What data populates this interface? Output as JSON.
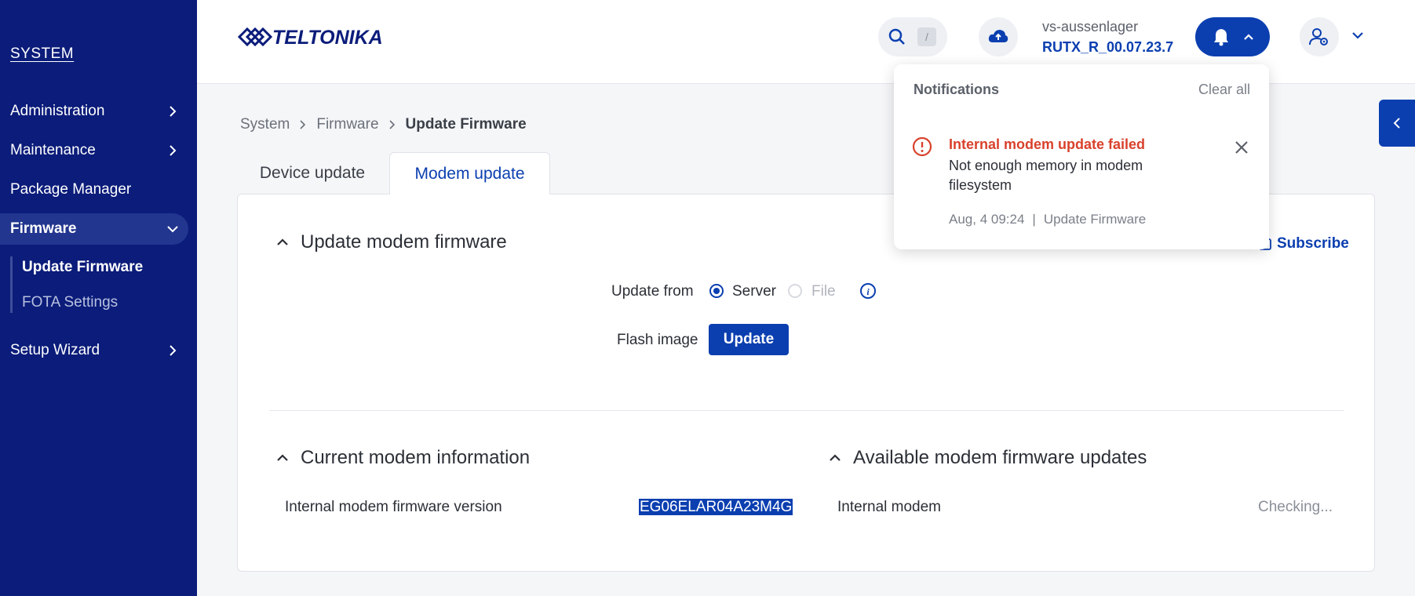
{
  "sidebar": {
    "section_title": "SYSTEM",
    "items": [
      {
        "label": "Administration"
      },
      {
        "label": "Maintenance"
      },
      {
        "label": "Package Manager"
      },
      {
        "label": "Firmware"
      },
      {
        "label": "Setup Wizard"
      }
    ],
    "firmware_sub": [
      {
        "label": "Update Firmware"
      },
      {
        "label": "FOTA Settings"
      }
    ]
  },
  "header": {
    "logo_text": "TELTONIKA",
    "search_shortcut": "/",
    "device_name": "vs-aussenlager",
    "firmware_version": "RUTX_R_00.07.23.7"
  },
  "breadcrumb": [
    "System",
    "Firmware",
    "Update Firmware"
  ],
  "tabs": [
    {
      "label": "Device update"
    },
    {
      "label": "Modem update"
    }
  ],
  "update_section": {
    "title": "Update modem firmware",
    "subscribe_label": "Subscribe",
    "update_from_label": "Update from",
    "options": [
      {
        "label": "Server",
        "selected": true
      },
      {
        "label": "File",
        "selected": false
      }
    ],
    "flash_image_label": "Flash image",
    "update_button": "Update"
  },
  "current_info": {
    "title": "Current modem information",
    "row_label": "Internal modem firmware version",
    "row_value": "EG06ELAR04A23M4G"
  },
  "available_updates": {
    "title": "Available modem firmware updates",
    "row_label": "Internal modem",
    "row_value": "Checking..."
  },
  "notifications": {
    "title": "Notifications",
    "clear_label": "Clear all",
    "item": {
      "heading": "Internal modem update failed",
      "body": "Not enough memory in modem filesystem",
      "time": "Aug, 4 09:24",
      "separator": "|",
      "source": "Update Firmware"
    }
  },
  "colors": {
    "sidebar_bg": "#0b1c7a",
    "primary": "#0b3fb0",
    "error": "#d9412c"
  }
}
